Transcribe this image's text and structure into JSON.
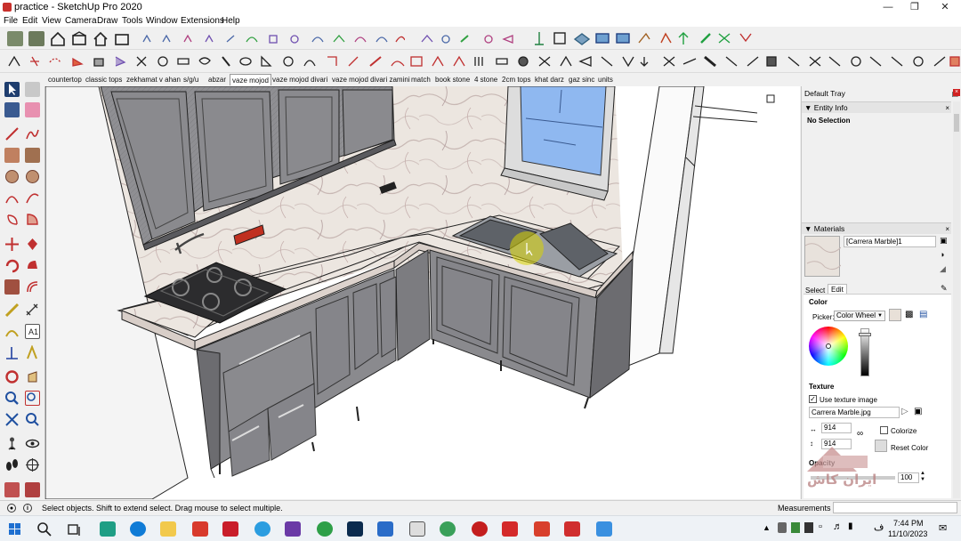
{
  "window": {
    "title": "practice - SketchUp Pro 2020"
  },
  "menu": [
    "File",
    "Edit",
    "View",
    "Camera",
    "Draw",
    "Tools",
    "Window",
    "Extensions",
    "Help"
  ],
  "scene_tabs": [
    {
      "label": "countertop",
      "active": false
    },
    {
      "label": "classic tops",
      "active": false
    },
    {
      "label": "zekhamat v ahan",
      "active": false
    },
    {
      "label": "s/g/u",
      "active": false
    },
    {
      "label": "abzar",
      "active": false
    },
    {
      "label": "vaze mojod",
      "active": true
    },
    {
      "label": "vaze mojod divari",
      "active": false
    },
    {
      "label": "vaze mojod divari zamini",
      "active": false
    },
    {
      "label": "match",
      "active": false
    },
    {
      "label": "book stone",
      "active": false
    },
    {
      "label": "4 stone",
      "active": false
    },
    {
      "label": "2cm tops",
      "active": false
    },
    {
      "label": "khat darz",
      "active": false
    },
    {
      "label": "gaz sinc",
      "active": false
    },
    {
      "label": "units",
      "active": false
    }
  ],
  "tray": {
    "title": "Default Tray",
    "entity_info": {
      "header": "Entity Info",
      "selection": "No Selection"
    },
    "materials": {
      "header": "Materials",
      "name_value": "[Carrera Marble]1",
      "tabs": [
        "Select",
        "Edit"
      ],
      "active_tab": "Edit",
      "color_label": "Color",
      "picker_label": "Picker:",
      "picker_value": "Color Wheel",
      "texture_label": "Texture",
      "use_texture_label": "Use texture image",
      "use_texture_checked": true,
      "texture_file": "Carrera Marble.jpg",
      "width_value": "914",
      "height_value": "914",
      "colorize_label": "Colorize",
      "reset_color_label": "Reset Color",
      "opacity_label": "Opacity",
      "opacity_value": "100"
    }
  },
  "status": {
    "message": "Select objects. Shift to extend select. Drag mouse to select multiple.",
    "measurements_label": "Measurements"
  },
  "taskbar": {
    "time": "7:44 PM",
    "date": "11/10/2023",
    "lang": "ف"
  },
  "watermark": "ایران کاش",
  "colors": {
    "accent": "#1a73e8",
    "marble": "#e9e2dc",
    "cabinet": "#8a8a8e",
    "window_glass": "#8fb8f0",
    "cursor_highlight": "#d8d400"
  }
}
